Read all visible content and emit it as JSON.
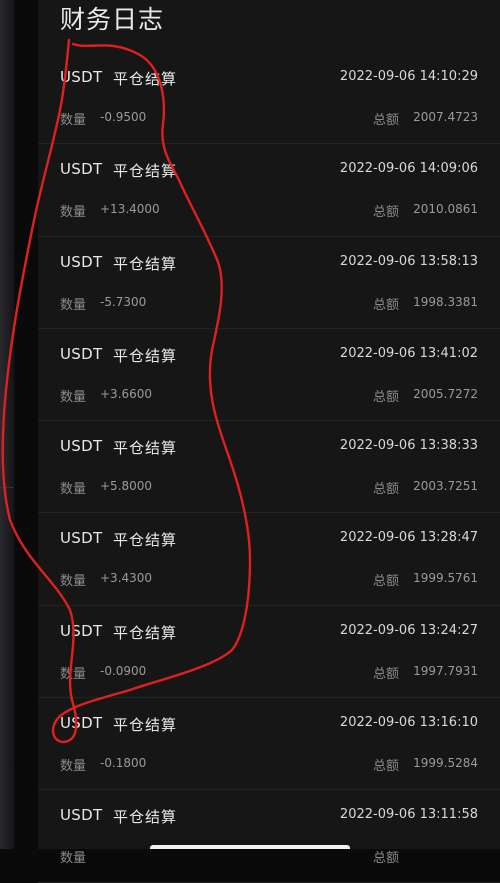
{
  "header": {
    "title": "财务日志"
  },
  "labels": {
    "quantity": "数量",
    "total": "总额"
  },
  "colors": {
    "annotation": "#e02020",
    "background": "#161616"
  },
  "entries": [
    {
      "asset": "USDT",
      "type": "平仓结算",
      "time": "2022-09-06 14:10:29",
      "amount": "-0.9500",
      "total": "2007.4723"
    },
    {
      "asset": "USDT",
      "type": "平仓结算",
      "time": "2022-09-06 14:09:06",
      "amount": "+13.4000",
      "total": "2010.0861"
    },
    {
      "asset": "USDT",
      "type": "平仓结算",
      "time": "2022-09-06 13:58:13",
      "amount": "-5.7300",
      "total": "1998.3381"
    },
    {
      "asset": "USDT",
      "type": "平仓结算",
      "time": "2022-09-06 13:41:02",
      "amount": "+3.6600",
      "total": "2005.7272"
    },
    {
      "asset": "USDT",
      "type": "平仓结算",
      "time": "2022-09-06 13:38:33",
      "amount": "+5.8000",
      "total": "2003.7251"
    },
    {
      "asset": "USDT",
      "type": "平仓结算",
      "time": "2022-09-06 13:28:47",
      "amount": "+3.4300",
      "total": "1999.5761"
    },
    {
      "asset": "USDT",
      "type": "平仓结算",
      "time": "2022-09-06 13:24:27",
      "amount": "-0.0900",
      "total": "1997.7931"
    },
    {
      "asset": "USDT",
      "type": "平仓结算",
      "time": "2022-09-06 13:16:10",
      "amount": "-0.1800",
      "total": "1999.5284"
    },
    {
      "asset": "USDT",
      "type": "平仓结算",
      "time": "2022-09-06 13:11:58",
      "amount": "",
      "total": ""
    }
  ]
}
